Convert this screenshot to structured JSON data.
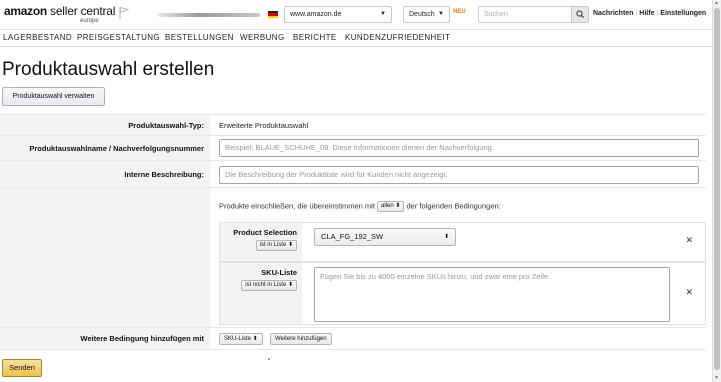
{
  "header": {
    "logo_brand": "amazon",
    "logo_product": " seller central",
    "logo_region": "europe",
    "marketplace": "www.amazon.de",
    "language": "Deutsch",
    "new_badge": "NEU",
    "search_placeholder": "Suchen",
    "links": [
      "Nachrichten",
      "Hilfe",
      "Einstellungen"
    ]
  },
  "nav": [
    "LAGERBESTAND",
    "PREISGESTALTUNG",
    "BESTELLUNGEN",
    "WERBUNG",
    "BERICHTE",
    "KUNDENZUFRIEDENHEIT"
  ],
  "page": {
    "title": "Produktauswahl erstellen",
    "manage_button": "Produktauswahl verwalten"
  },
  "form": {
    "type_label": "Produktauswahl-Typ:",
    "type_value": "Erweiterte Produktauswahl",
    "name_label": "Produktauswahlname / Nachverfolgungsnummer",
    "name_placeholder": "Beispiel: BLAUE_SCHUHE_08. Diese Informationen dienen der Nachverfolgung.",
    "desc_label": "Interne Beschreibung:",
    "desc_placeholder": "Die Beschreibung der Produktliste wird für Kunden nicht angezeigt.",
    "cond_intro_before": "Produkte einschließen, die übereinstimmen mit",
    "cond_match": "allen",
    "cond_intro_after": "der folgenden Bedingungen:",
    "conditions": [
      {
        "label": "Product Selection",
        "operator": "ist in Liste",
        "value": "CLA_FG_192_SW"
      },
      {
        "label": "SKU-Liste",
        "operator": "ist nicht in Liste",
        "placeholder": "Fügen Sie bis zu 4000 einzelne SKUs hinzu, und zwar eine pro Zeile."
      }
    ],
    "add_label": "Weitere Bedingung hinzufügen mit",
    "add_select": "SKU-Liste",
    "add_button": "Weitere hinzufügen",
    "submit": "Senden"
  },
  "colors": {
    "accent": "#f0c14b",
    "new_badge": "#e47911"
  }
}
